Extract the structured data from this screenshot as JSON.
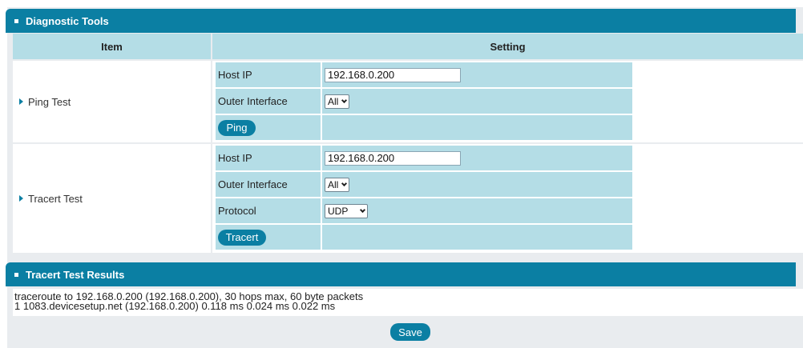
{
  "diagnostic": {
    "title": "Diagnostic Tools",
    "col_item": "Item",
    "col_setting": "Setting"
  },
  "ping": {
    "label": "Ping Test",
    "host_ip_label": "Host IP",
    "host_ip_value": "192.168.0.200",
    "outer_interface_label": "Outer Interface",
    "outer_interface_value": "All",
    "button": "Ping"
  },
  "tracert": {
    "label": "Tracert Test",
    "host_ip_label": "Host IP",
    "host_ip_value": "192.168.0.200",
    "outer_interface_label": "Outer Interface",
    "outer_interface_value": "All",
    "protocol_label": "Protocol",
    "protocol_value": "UDP",
    "button": "Tracert"
  },
  "results": {
    "title": "Tracert Test Results",
    "lines": [
      "traceroute to 192.168.0.200 (192.168.0.200), 30 hops max, 60 byte packets",
      "1 1083.devicesetup.net (192.168.0.200) 0.118 ms 0.024 ms 0.022 ms"
    ]
  },
  "save_label": "Save",
  "colors": {
    "accent": "#0b7fa3",
    "cell_bg": "#b4dde6",
    "frame_bg": "#e9ecef"
  },
  "icons": {
    "section_bullet": "square-bullet-icon",
    "row_marker": "triangle-right-icon",
    "dropdown": "chevron-down-icon"
  }
}
